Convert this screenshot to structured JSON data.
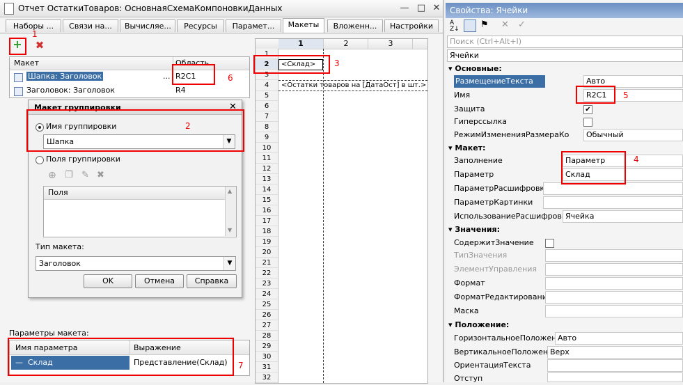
{
  "window": {
    "title": "Отчет ОстаткиТоваров: ОсновнаяСхемаКомпоновкиДанных",
    "tabs": [
      "Наборы ...",
      "Связи на...",
      "Вычисляе...",
      "Ресурсы",
      "Парамет...",
      "Макеты",
      "Вложенн...",
      "Настройки"
    ],
    "active_tab": "Макеты"
  },
  "toolbar": {
    "add_icon": "add-icon",
    "delete_icon": "delete-icon"
  },
  "annotations": [
    "1",
    "2",
    "3",
    "4",
    "5",
    "6",
    "7"
  ],
  "layouts_table": {
    "columns": [
      "Макет",
      "Область"
    ],
    "rows": [
      {
        "name": "Шапка: Заголовок",
        "area": "R2C1",
        "ellipsis": "..."
      },
      {
        "name": "Заголовок: Заголовок",
        "area": "R4"
      }
    ]
  },
  "group_dialog": {
    "title": "Макет группировки",
    "group_name_label": "Имя группировки",
    "group_name_value": "Шапка",
    "group_fields_label": "Поля группировки",
    "fields_column": "Поля",
    "layout_type_label": "Тип макета:",
    "layout_type_value": "Заголовок",
    "ok": "OK",
    "cancel": "Отмена",
    "help": "Справка"
  },
  "layout_params": {
    "label": "Параметры макета:",
    "columns": [
      "Имя параметра",
      "Выражение"
    ],
    "rows": [
      {
        "dash": "—",
        "name": "Склад",
        "expr": "Представление(Склад)"
      }
    ]
  },
  "spreadsheet": {
    "columns": [
      "1",
      "2",
      "3"
    ],
    "rows": [
      "1",
      "2",
      "3",
      "4",
      "5",
      "6",
      "7",
      "8",
      "9",
      "10",
      "11",
      "12",
      "13",
      "14",
      "15",
      "16",
      "17",
      "18",
      "19",
      "20",
      "21",
      "22",
      "23",
      "24",
      "25",
      "26",
      "27",
      "28",
      "29",
      "30",
      "31",
      "32"
    ],
    "cell_r2": "<Склад>",
    "cell_r4": "<Остатки товаров на [ДатаОст] в шт.>"
  },
  "properties": {
    "title": "Свойства: Ячейки",
    "search_placeholder": "Поиск (Ctrl+Alt+I)",
    "object": "Ячейки",
    "groups": {
      "basic": "Основные:",
      "layout": "Макет:",
      "values": "Значения:",
      "position": "Положение:"
    },
    "basic": [
      {
        "label": "РазмещениеТекста",
        "value": "Авто"
      },
      {
        "label": "Имя",
        "value": "R2C1"
      },
      {
        "label": "Защита",
        "check": "✔"
      },
      {
        "label": "Гиперссылка"
      },
      {
        "label": "РежимИзмененияРазмераКолонки",
        "value": "Обычный"
      }
    ],
    "layout": [
      {
        "label": "Заполнение",
        "value": "Параметр"
      },
      {
        "label": "Параметр",
        "value": "Склад"
      },
      {
        "label": "ПараметрРасшифровки"
      },
      {
        "label": "ПараметрКартинки"
      },
      {
        "label": "ИспользованиеРасшифровки",
        "value": "Ячейка"
      }
    ],
    "values": [
      {
        "label": "СодержитЗначение"
      },
      {
        "label": "ТипЗначения"
      },
      {
        "label": "ЭлементУправления"
      },
      {
        "label": "Формат"
      },
      {
        "label": "ФорматРедактирования"
      },
      {
        "label": "Маска"
      }
    ],
    "position": [
      {
        "label": "ГоризонтальноеПоложение",
        "value": "Авто"
      },
      {
        "label": "ВертикальноеПоложение",
        "value": "Верх"
      },
      {
        "label": "ОриентацияТекста"
      },
      {
        "label": "Отступ"
      }
    ]
  }
}
